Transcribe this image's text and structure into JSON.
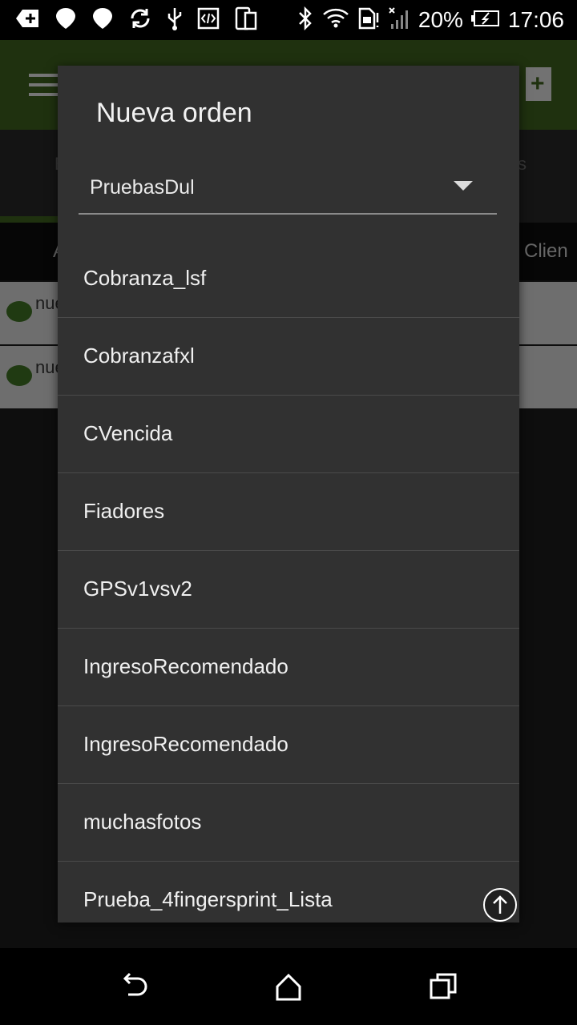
{
  "status_bar": {
    "battery_percent": "20%",
    "time": "17:06",
    "icons": [
      "add-box-icon",
      "pin-icon",
      "pin-icon",
      "sync-icon",
      "usb-icon",
      "code-icon",
      "devices-icon",
      "bluetooth-icon",
      "wifi-icon",
      "sim-icon",
      "signal-icon",
      "battery-charging-icon"
    ]
  },
  "background": {
    "tab_partial_right": "s",
    "tab_partial_left": "E",
    "column_right_partial": "re Clien",
    "column_left_partial": "A",
    "rows": [
      {
        "text": "nue"
      },
      {
        "text": "nue"
      }
    ]
  },
  "dialog": {
    "title": "Nueva orden",
    "selected": "PruebasDul",
    "items": [
      {
        "label": "Cobranza_lsf"
      },
      {
        "label": "Cobranzafxl"
      },
      {
        "label": "CVencida"
      },
      {
        "label": "Fiadores"
      },
      {
        "label": "GPSv1vsv2"
      },
      {
        "label": "IngresoRecomendado"
      },
      {
        "label": "IngresoRecomendado"
      },
      {
        "label": "muchasfotos"
      },
      {
        "label": "Prueba_4fingersprint_Lista"
      }
    ]
  },
  "navbar": {
    "icons": [
      "back-icon",
      "home-icon",
      "recents-icon"
    ]
  },
  "colors": {
    "appbar": "#3a5a1c",
    "dialog": "#313131",
    "divider": "#4a4a4a"
  }
}
